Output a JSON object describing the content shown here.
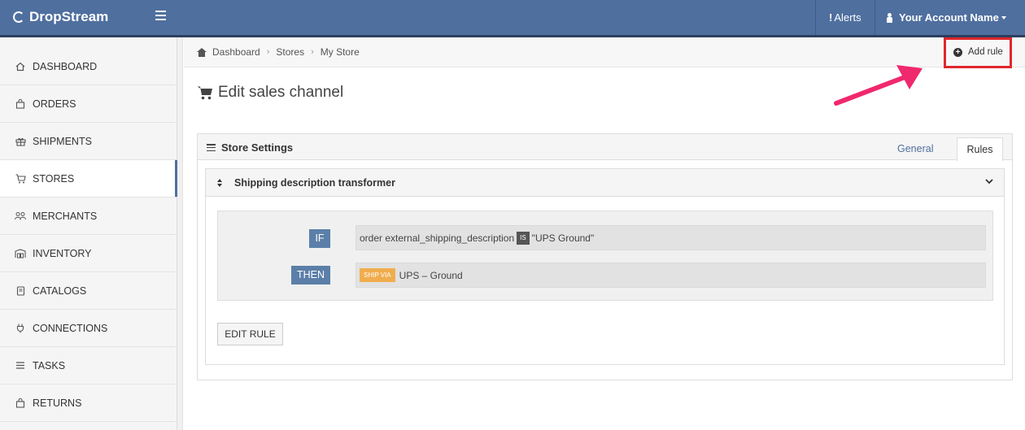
{
  "app": {
    "brand": "DropStream"
  },
  "topnav": {
    "alerts_label": "Alerts",
    "account_label": "Your Account Name"
  },
  "sidebar": {
    "items": [
      {
        "label": "DASHBOARD",
        "icon": "home-icon"
      },
      {
        "label": "ORDERS",
        "icon": "bag-icon"
      },
      {
        "label": "SHIPMENTS",
        "icon": "gift-icon"
      },
      {
        "label": "STORES",
        "icon": "cart-icon",
        "active": true
      },
      {
        "label": "MERCHANTS",
        "icon": "users-icon"
      },
      {
        "label": "INVENTORY",
        "icon": "warehouse-icon"
      },
      {
        "label": "CATALOGS",
        "icon": "book-icon"
      },
      {
        "label": "CONNECTIONS",
        "icon": "plug-icon"
      },
      {
        "label": "TASKS",
        "icon": "list-icon"
      },
      {
        "label": "RETURNS",
        "icon": "return-bag-icon"
      }
    ]
  },
  "breadcrumb": {
    "items": [
      "Dashboard",
      "Stores",
      "My Store"
    ]
  },
  "actions": {
    "add_rule_label": "Add rule"
  },
  "page": {
    "title": "Edit sales channel"
  },
  "panel": {
    "title": "Store Settings",
    "tabs": {
      "general": "General",
      "rules": "Rules"
    }
  },
  "rule": {
    "title": "Shipping description transformer",
    "if_label": "IF",
    "then_label": "THEN",
    "condition_field": "order external_shipping_description",
    "condition_operator": "IS",
    "condition_value": "\"UPS Ground\"",
    "action_badge": "SHIP VIA",
    "action_value": "UPS – Ground",
    "edit_button": "EDIT RULE"
  },
  "colors": {
    "topbar": "#4f6f9f",
    "highlight_box": "#e0262c",
    "annotation_arrow": "#f0286e",
    "keyword_badge": "#5b7fa8",
    "ship_via_badge": "#f0ad4e"
  }
}
